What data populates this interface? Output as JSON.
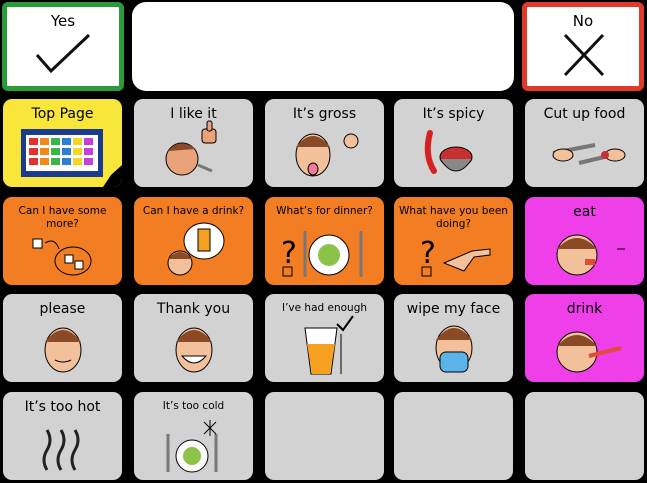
{
  "top_bar": {
    "yes_label": "Yes",
    "no_label": "No",
    "message_text": ""
  },
  "grid": {
    "row1": [
      "Top Page",
      "I like it",
      "It’s gross",
      "It’s spicy",
      "Cut up food"
    ],
    "row2": [
      "Can I have some more?",
      "Can I have a drink?",
      "What’s for dinner?",
      "What have you been doing?",
      "eat"
    ],
    "row3": [
      "please",
      "Thank you",
      "I’ve had enough",
      "wipe my face",
      "drink"
    ],
    "row4": [
      "It’s too hot",
      "It’s too cold",
      "",
      "",
      ""
    ]
  },
  "colors": {
    "yes_border": "#2a9a3a",
    "no_border": "#e23a2a",
    "tile_gray": "#d2d2d2",
    "tile_orange": "#f27d22",
    "tile_magenta": "#ee3fe9",
    "tile_yellow": "#f8e73a"
  }
}
